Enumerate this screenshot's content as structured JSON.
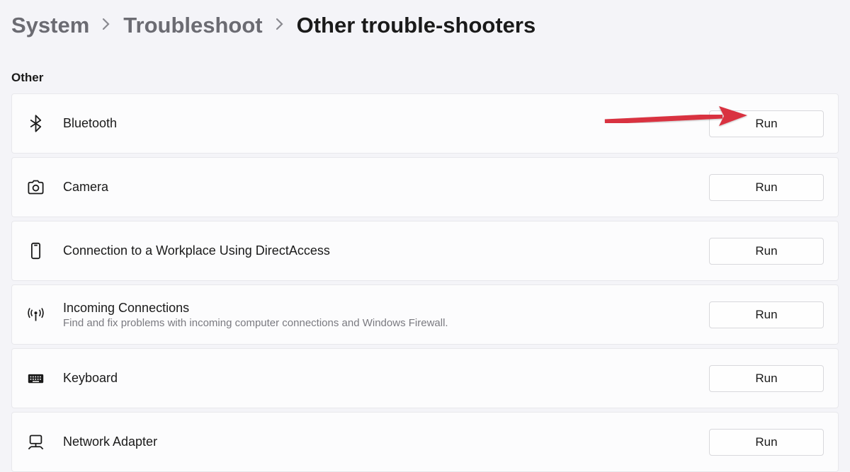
{
  "breadcrumb": {
    "items": [
      {
        "label": "System",
        "current": false
      },
      {
        "label": "Troubleshoot",
        "current": false
      },
      {
        "label": "Other trouble-shooters",
        "current": true
      }
    ]
  },
  "section": {
    "header": "Other"
  },
  "troubleshooters": [
    {
      "name": "bluetooth",
      "label": "Bluetooth",
      "desc": null,
      "button": "Run",
      "icon": "bluetooth-icon"
    },
    {
      "name": "camera",
      "label": "Camera",
      "desc": null,
      "button": "Run",
      "icon": "camera-icon"
    },
    {
      "name": "directaccess",
      "label": "Connection to a Workplace Using DirectAccess",
      "desc": null,
      "button": "Run",
      "icon": "phone-icon"
    },
    {
      "name": "incoming-connections",
      "label": "Incoming Connections",
      "desc": "Find and fix problems with incoming computer connections and Windows Firewall.",
      "button": "Run",
      "icon": "antenna-icon"
    },
    {
      "name": "keyboard",
      "label": "Keyboard",
      "desc": null,
      "button": "Run",
      "icon": "keyboard-icon"
    },
    {
      "name": "network-adapter",
      "label": "Network Adapter",
      "desc": null,
      "button": "Run",
      "icon": "network-icon"
    }
  ],
  "annotation": {
    "type": "arrow",
    "color": "#d9303f",
    "target": "bluetooth-run"
  }
}
